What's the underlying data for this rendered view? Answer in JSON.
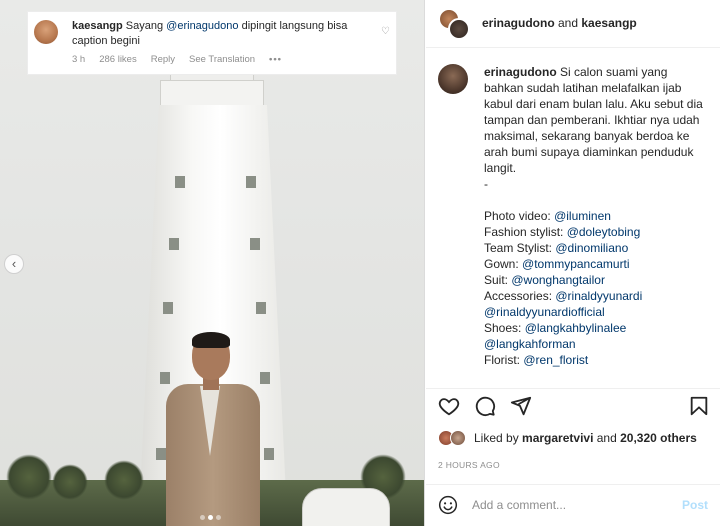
{
  "comment": {
    "username": "kaesangp",
    "text_before": " Sayang ",
    "mention": "@erinagudono",
    "text_after": " dipingit langsung bisa caption begini",
    "time": "3 h",
    "likes": "286 likes",
    "reply": "Reply",
    "translation": "See Translation",
    "more": "•••"
  },
  "header": {
    "user1": "erinagudono",
    "and": " and ",
    "user2": "kaesangp"
  },
  "caption": {
    "username": "erinagudono",
    "body": " Si calon suami yang bahkan sudah latihan melafalkan ijab kabul dari enam bulan lalu. Aku sebut dia tampan dan pemberani. Ikhtiar nya udah maksimal, sekarang banyak berdoa ke arah bumi supaya diaminkan penduduk langit.",
    "dash": "-",
    "credits": [
      {
        "label": "Photo video: ",
        "mention": "@iluminen"
      },
      {
        "label": "Fashion stylist: ",
        "mention": "@doleytobing"
      },
      {
        "label": "Team Stylist: ",
        "mention": "@dinomiliano"
      },
      {
        "label": "Gown: ",
        "mention": "@tommypancamurti"
      },
      {
        "label": "Suit: ",
        "mention": "@wonghangtailor"
      },
      {
        "label": "Accessories: ",
        "mention": "@rinaldyyunardi"
      },
      {
        "label": "",
        "mention": "@rinaldyyunardiofficial"
      },
      {
        "label": "Shoes: ",
        "mention": "@langkahbylinalee"
      },
      {
        "label": "",
        "mention": "@langkahforman"
      },
      {
        "label": "Florist: ",
        "mention": "@ren_florist"
      }
    ]
  },
  "likes": {
    "prefix": "Liked by ",
    "user": "margaretvivi",
    "middle": " and ",
    "count": "20,320 others"
  },
  "time": "2 HOURS AGO",
  "add_comment": {
    "placeholder": "Add a comment...",
    "post": "Post"
  },
  "icons": {
    "prev": "‹",
    "heart": "♡"
  },
  "colors": {
    "mention": "#00376b",
    "muted": "#8e8e8e",
    "post_disabled": "#b2dffc"
  }
}
